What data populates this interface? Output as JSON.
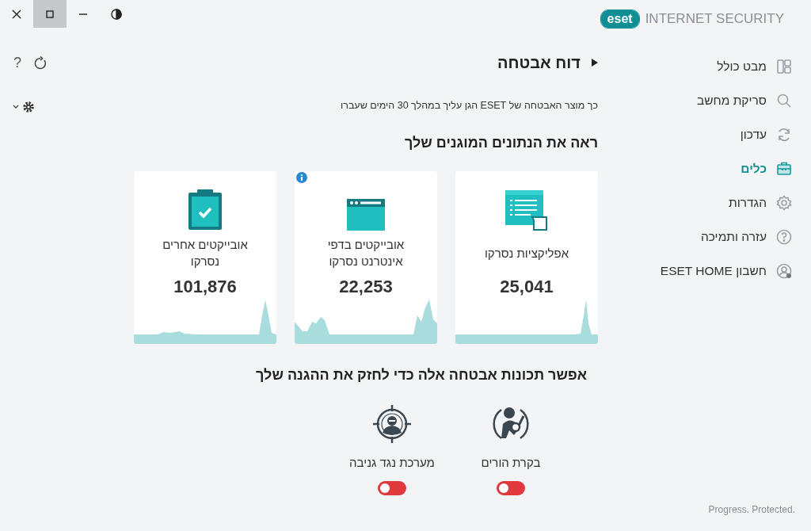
{
  "window": {
    "product": "INTERNET SECURITY",
    "logo": "eset",
    "controls": [
      {
        "kind": "close",
        "hovered": false
      },
      {
        "kind": "maximize",
        "hovered": true
      },
      {
        "kind": "minimize",
        "hovered": false
      },
      {
        "kind": "contrast",
        "hovered": false
      }
    ]
  },
  "toolbar": [
    {
      "kind": "help",
      "label": "?"
    },
    {
      "kind": "refresh"
    },
    {
      "kind": "settings"
    }
  ],
  "sidebar": {
    "items": [
      {
        "label": "מבט כולל",
        "kind": "overview",
        "selected": false
      },
      {
        "label": "סריקת מחשב",
        "kind": "scan",
        "selected": false
      },
      {
        "label": "עדכון",
        "kind": "update",
        "selected": false
      },
      {
        "label": "כלים",
        "kind": "tools",
        "selected": true
      },
      {
        "label": "הגדרות",
        "kind": "setup",
        "selected": false
      },
      {
        "label": "עזרה ותמיכה",
        "kind": "help",
        "selected": false
      },
      {
        "label": "חשבון ESET HOME",
        "kind": "account",
        "selected": false
      }
    ]
  },
  "page": {
    "title": "דוח אבטחה",
    "subtitle": "כך מוצר האבטחה של ESET הגן עליך במהלך 30 הימים שעברו",
    "stats_heading": "ראה את הנתונים המוגנים שלך",
    "cards": [
      {
        "kind": "apps",
        "label": "אפליקציות נסרקו",
        "value": "25,041",
        "info": false
      },
      {
        "kind": "web",
        "label": "אובייקטים בדפי אינטרנט נסרקו",
        "value": "22,253",
        "info": true
      },
      {
        "kind": "other",
        "label": "אובייקטים אחרים נסרקו",
        "value": "101,876",
        "info": false
      }
    ],
    "features_heading": "אפשר תכונות אבטחה אלה כדי לחזק את ההגנה שלך",
    "features": [
      {
        "kind": "parental",
        "label": "בקרת הורים",
        "on": false
      },
      {
        "kind": "antitheft",
        "label": "מערכת נגד גניבה",
        "on": false
      }
    ]
  },
  "footer": "Progress. Protected."
}
